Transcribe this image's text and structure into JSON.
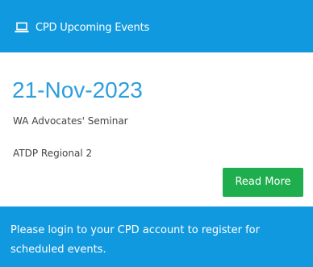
{
  "colors": {
    "accent": "#1199df",
    "date_text": "#2c9ede",
    "button": "#1fae4e"
  },
  "header": {
    "icon": "laptop-icon",
    "title": "CPD Upcoming Events"
  },
  "event": {
    "date": "21-Nov-2023",
    "title": "WA Advocates' Seminar",
    "subtitle": "ATDP Regional 2",
    "read_more_label": "Read More"
  },
  "footer": {
    "message": "Please login to your CPD account to register for scheduled events."
  }
}
